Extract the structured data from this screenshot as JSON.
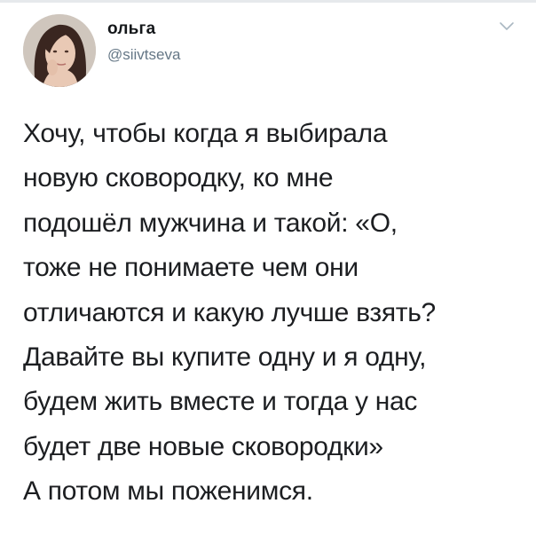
{
  "author": {
    "name": "ольга",
    "handle": "@siivtseva"
  },
  "icons": {
    "avatar": "profile-photo",
    "caret": "chevron-down-icon"
  },
  "colors": {
    "text": "#1c1e21",
    "handle": "#657786",
    "caret": "#aab8c2"
  },
  "tweet": {
    "lines": [
      "Хочу, чтобы когда я выбирала",
      "новую сковородку, ко мне",
      "подошёл мужчина и такой: «О,",
      "тоже не понимаете чем они",
      "отличаются и какую лучше взять?",
      "Давайте вы купите одну и я одну,",
      "будем жить вместе и тогда у нас",
      "будет две новые сковородки»",
      "А потом мы поженимся."
    ]
  }
}
